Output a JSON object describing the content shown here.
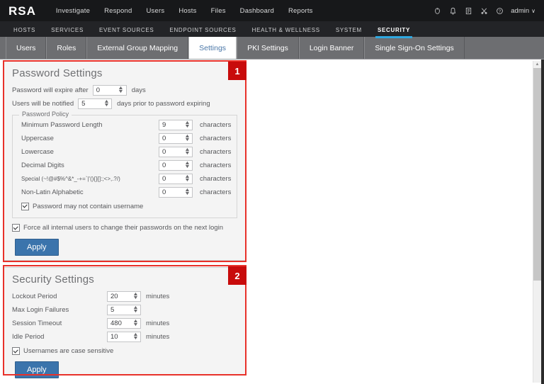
{
  "brand": {
    "logo": "RSA"
  },
  "topnav": {
    "items": [
      {
        "label": "Investigate"
      },
      {
        "label": "Respond"
      },
      {
        "label": "Users"
      },
      {
        "label": "Hosts"
      },
      {
        "label": "Files"
      },
      {
        "label": "Dashboard"
      },
      {
        "label": "Reports"
      }
    ],
    "icons": [
      {
        "name": "lifering-icon",
        "glyph": "○"
      },
      {
        "name": "bell-icon",
        "glyph": "⌂"
      },
      {
        "name": "tasks-icon",
        "glyph": "▤"
      },
      {
        "name": "settings-icon",
        "glyph": "✂"
      },
      {
        "name": "help-icon",
        "glyph": "?"
      }
    ],
    "user": {
      "label": "admin",
      "caret": "∨"
    }
  },
  "subnav": {
    "items": [
      {
        "label": "HOSTS",
        "active": false
      },
      {
        "label": "SERVICES",
        "active": false
      },
      {
        "label": "EVENT SOURCES",
        "active": false
      },
      {
        "label": "ENDPOINT SOURCES",
        "active": false
      },
      {
        "label": "HEALTH & WELLNESS",
        "active": false
      },
      {
        "label": "SYSTEM",
        "active": false
      },
      {
        "label": "SECURITY",
        "active": true
      }
    ]
  },
  "tabs": [
    {
      "label": "Users",
      "active": false
    },
    {
      "label": "Roles",
      "active": false
    },
    {
      "label": "External Group Mapping",
      "active": false
    },
    {
      "label": "Settings",
      "active": true
    },
    {
      "label": "PKI Settings",
      "active": false
    },
    {
      "label": "Login Banner",
      "active": false
    },
    {
      "label": "Single Sign-On Settings",
      "active": false
    }
  ],
  "annotations": [
    {
      "number": "1",
      "color": "#c80b0b"
    },
    {
      "number": "2",
      "color": "#c80b0b"
    }
  ],
  "password_settings": {
    "title": "Password Settings",
    "expire": {
      "label_before": "Password will expire after",
      "value": "0",
      "label_after": "days"
    },
    "notify": {
      "label_before": "Users will be notified",
      "value": "5",
      "label_after": "days prior to password expiring"
    },
    "policy": {
      "legend": "Password Policy",
      "unit": "characters",
      "rows": [
        {
          "label": "Minimum Password Length",
          "value": "9",
          "unit": "characters"
        },
        {
          "label": "Uppercase",
          "value": "0",
          "unit": "characters"
        },
        {
          "label": "Lowercase",
          "value": "0",
          "unit": "characters"
        },
        {
          "label": "Decimal Digits",
          "value": "0",
          "unit": "characters"
        },
        {
          "label": "Special (~!@#$%^&*_-+=`|'(){}[]:;<>,.?/)",
          "value": "0",
          "unit": "characters"
        },
        {
          "label": "Non-Latin Alphabetic",
          "value": "0",
          "unit": "characters"
        }
      ],
      "no_username_checkbox": {
        "label": "Password may not contain username",
        "checked": true
      }
    },
    "force_change_checkbox": {
      "label": "Force all internal users to change their passwords on the next login",
      "checked": true
    },
    "apply_label": "Apply"
  },
  "security_settings": {
    "title": "Security Settings",
    "rows": [
      {
        "label": "Lockout Period",
        "value": "20",
        "unit": "minutes"
      },
      {
        "label": "Max Login Failures",
        "value": "5",
        "unit": ""
      },
      {
        "label": "Session Timeout",
        "value": "480",
        "unit": "minutes"
      },
      {
        "label": "Idle Period",
        "value": "10",
        "unit": "minutes"
      }
    ],
    "case_sensitive_checkbox": {
      "label": "Usernames are case sensitive",
      "checked": true
    },
    "apply_label": "Apply"
  },
  "colors": {
    "accent_blue": "#2fa8e0",
    "annotation_red": "#e8312a",
    "badge_red": "#c80b0b",
    "apply_blue": "#3b74ac",
    "tab_active_text": "#4b77a8"
  }
}
